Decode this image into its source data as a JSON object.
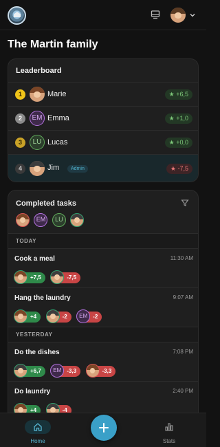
{
  "app": {
    "family_title": "The Martin family",
    "icons": {
      "logo": "family-home-logo",
      "screen": "monitor-icon",
      "menu": "chevron-down-icon"
    }
  },
  "leaderboard": {
    "title": "Leaderboard",
    "rows": [
      {
        "rank": "1",
        "name": "Marie",
        "avatar": "photo",
        "score": "+6,5",
        "trend": "positive",
        "rank_color": "#f0c419"
      },
      {
        "rank": "2",
        "name": "Emma",
        "avatar": "EM",
        "score": "+1,0",
        "trend": "positive",
        "rank_color": "#8a8a8a"
      },
      {
        "rank": "3",
        "name": "Lucas",
        "avatar": "LU",
        "score": "+0,0",
        "trend": "positive",
        "rank_color": "#c9a227"
      },
      {
        "rank": "4",
        "name": "Jim",
        "avatar": "photo",
        "badge": "Admin",
        "score": "-7,5",
        "trend": "negative",
        "rank_color": "#3a3a3a"
      }
    ]
  },
  "tasks": {
    "title": "Completed tasks",
    "members": [
      "photo-marie",
      "EM",
      "LU",
      "photo-jim"
    ],
    "sections": [
      {
        "label": "TODAY"
      },
      {
        "label": "YESTERDAY"
      }
    ],
    "items": [
      {
        "name": "Cook a meal",
        "time": "11:30 AM",
        "chips": [
          {
            "avatar": "photo",
            "amount": "+7,5",
            "kind": "pos"
          },
          {
            "avatar": "photo",
            "amount": "-7,5",
            "kind": "neg"
          }
        ]
      },
      {
        "name": "Hang the laundry",
        "time": "9:07 AM",
        "chips": [
          {
            "avatar": "photo",
            "amount": "+4",
            "kind": "pos"
          },
          {
            "avatar": "photo",
            "amount": "-2",
            "kind": "neg"
          },
          {
            "avatar": "EM",
            "amount": "-2",
            "kind": "neg"
          }
        ]
      },
      {
        "name": "Do the dishes",
        "time": "7:08 PM",
        "chips": [
          {
            "avatar": "photo",
            "amount": "+6,7",
            "kind": "pos"
          },
          {
            "avatar": "EM",
            "amount": "-3,3",
            "kind": "neg"
          },
          {
            "avatar": "photo",
            "amount": "-3,3",
            "kind": "neg"
          }
        ]
      },
      {
        "name": "Do laundry",
        "time": "2:40 PM",
        "chips": [
          {
            "avatar": "photo",
            "amount": "+4",
            "kind": "pos"
          },
          {
            "avatar": "photo",
            "amount": "-4",
            "kind": "neg"
          }
        ]
      }
    ]
  },
  "nav": {
    "home_label": "Home",
    "stats_label": "Stats",
    "accent": "#3aa0c8"
  }
}
